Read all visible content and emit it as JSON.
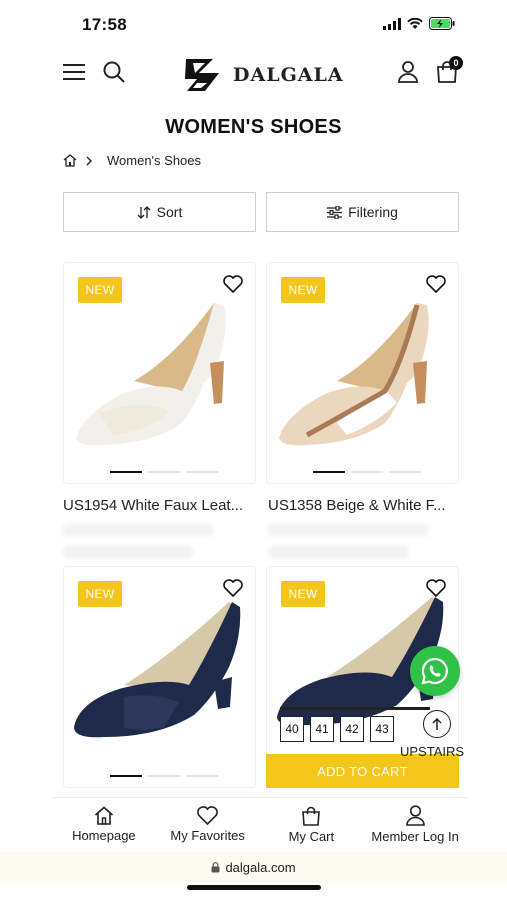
{
  "status": {
    "time": "17:58"
  },
  "header": {
    "brand": "DALGALA",
    "cart_count": "0"
  },
  "page": {
    "title": "WOMEN'S SHOES",
    "breadcrumb": "Women's Shoes"
  },
  "toolbar": {
    "sort_label": "Sort",
    "filter_label": "Filtering"
  },
  "products": [
    {
      "badge": "NEW",
      "name": "US1954 White Faux Leat...",
      "colors": {
        "base": "#f2f0ea",
        "accent": "#efe7d6",
        "heel": "#c58f5d",
        "lining": "#d9b98a"
      }
    },
    {
      "badge": "NEW",
      "name": "US1358 Beige & White F...",
      "colors": {
        "base": "#ead7bd",
        "accent": "#ffffff",
        "heel": "#c58f5d",
        "lining": "#d9b98a"
      }
    },
    {
      "badge": "NEW",
      "name": "",
      "colors": {
        "base": "#1f2a4a",
        "accent": "#2f3b5e",
        "heel": "#1f2a4a",
        "lining": "#d6c9a8"
      }
    },
    {
      "badge": "NEW",
      "name": "",
      "colors": {
        "base": "#1f2a4a",
        "accent": "#2f3b5e",
        "heel": "#1f2a4a",
        "lining": "#d6c9a8"
      }
    }
  ],
  "quick_add": {
    "sizes": [
      "40",
      "41",
      "42",
      "43"
    ],
    "add_to_cart": "ADD TO CART"
  },
  "float": {
    "upstairs": "UPSTAIRS"
  },
  "bottom_nav": [
    {
      "label": "Homepage",
      "icon": "home-icon"
    },
    {
      "label": "My Favorites",
      "icon": "heart-icon"
    },
    {
      "label": "My Cart",
      "icon": "bag-icon"
    },
    {
      "label": "Member Log In",
      "icon": "user-icon"
    }
  ],
  "browser": {
    "url": "dalgala.com"
  },
  "colors": {
    "accent": "#f4c51b",
    "whatsapp": "#2fc246"
  }
}
